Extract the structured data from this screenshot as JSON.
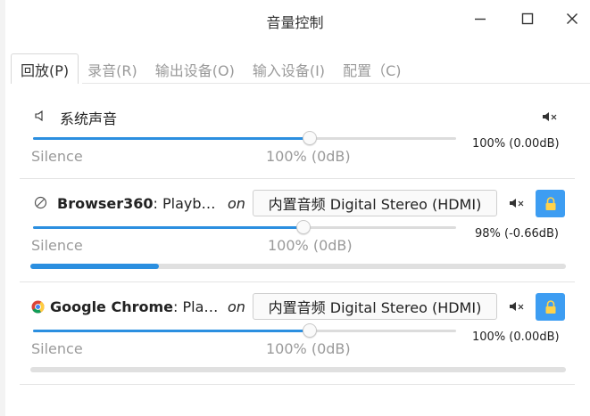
{
  "window": {
    "title": "音量控制"
  },
  "tabs": [
    {
      "label": "回放(P)",
      "active": true
    },
    {
      "label": "录音(R)",
      "active": false
    },
    {
      "label": "输出设备(O)",
      "active": false
    },
    {
      "label": "输入设备(I)",
      "active": false
    },
    {
      "label": "配置（C)",
      "active": false
    }
  ],
  "system_sound": {
    "label": "系统声音",
    "volume_text": "100% (0.00dB)",
    "silence_label": "Silence",
    "mark_label": "100% (0dB)",
    "volume_fraction": 1.0
  },
  "streams": [
    {
      "app": "Browser360",
      "suffix": ": Playb…",
      "on_label": "on",
      "device": "内置音频 Digital Stereo (HDMI)",
      "volume_text": "98% (-0.66dB)",
      "silence_label": "Silence",
      "mark_label": "100% (0dB)",
      "volume_fraction": 0.98,
      "peak_fraction": 0.24,
      "icon": "disabled-circle-icon"
    },
    {
      "app": "Google Chrome",
      "suffix": ": Pla…",
      "on_label": "on",
      "device": "内置音频 Digital Stereo (HDMI)",
      "volume_text": "100% (0.00dB)",
      "silence_label": "Silence",
      "mark_label": "100% (0dB)",
      "volume_fraction": 1.0,
      "peak_fraction": 0.0,
      "icon": "chrome-icon"
    }
  ],
  "colors": {
    "accent": "#2b8fe0",
    "lock_button": "#3d9df2"
  }
}
